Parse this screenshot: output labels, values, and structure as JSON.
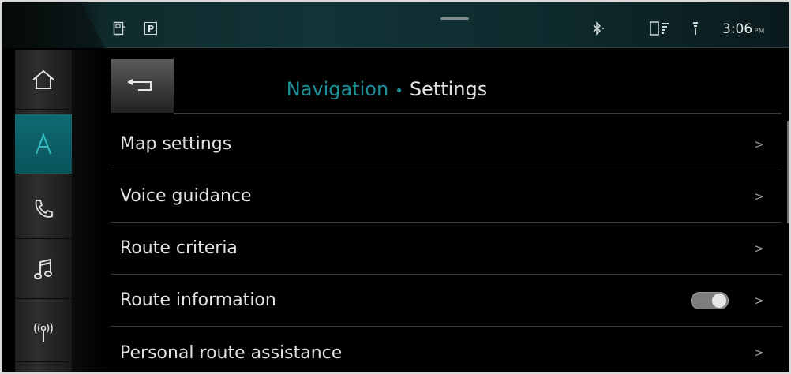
{
  "status_bar": {
    "park_label": "P",
    "time": "3:06",
    "time_suffix": "PM",
    "icons": [
      "vehicle-icon",
      "park-icon",
      "bluetooth-icon",
      "phone-battery-icon",
      "signal-icon"
    ]
  },
  "rail": {
    "items": [
      {
        "name": "home",
        "icon": "home-icon",
        "active": false
      },
      {
        "name": "navigation",
        "icon": "navigation-icon",
        "active": true
      },
      {
        "name": "phone",
        "icon": "phone-icon",
        "active": false
      },
      {
        "name": "media",
        "icon": "music-note-icon",
        "active": false
      },
      {
        "name": "radio",
        "icon": "antenna-icon",
        "active": false
      }
    ]
  },
  "header": {
    "section": "Navigation",
    "separator": "•",
    "page": "Settings",
    "back_icon": "back-arrow-icon"
  },
  "list": {
    "items": [
      {
        "label": "Map settings"
      },
      {
        "label": "Voice guidance"
      },
      {
        "label": "Route criteria"
      },
      {
        "label": "Route information",
        "toggle_on": true
      },
      {
        "label": "Personal route assistance"
      }
    ],
    "chevron": ">"
  },
  "colors": {
    "accent": "#1f8f97",
    "active_rail": "#0f6a72",
    "background": "#000000",
    "text": "#e4e4e4"
  }
}
